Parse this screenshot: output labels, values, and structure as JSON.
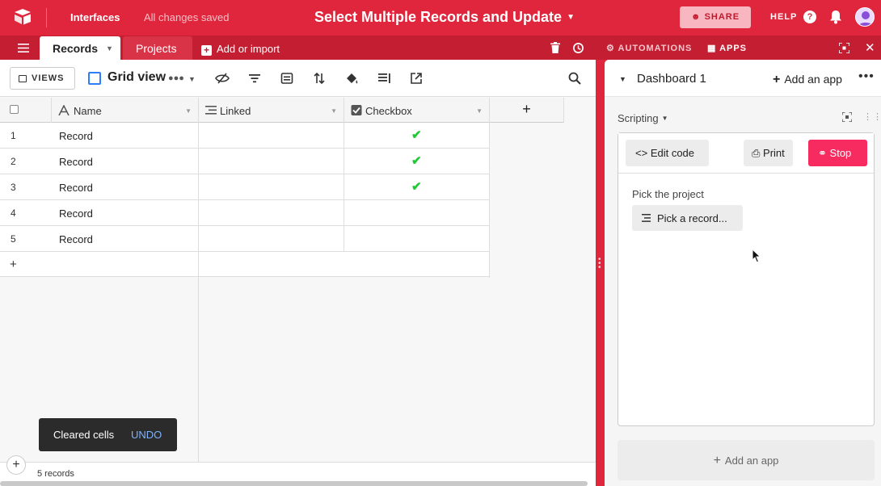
{
  "topbar": {
    "interfaces": "Interfaces",
    "saved": "All changes saved",
    "base_title": "Select Multiple Records and Update",
    "share": "SHARE",
    "help": "HELP"
  },
  "tabs": {
    "records": "Records",
    "projects": "Projects",
    "add_or_import": "Add or import",
    "automations": "AUTOMATIONS",
    "apps": "APPS"
  },
  "viewbar": {
    "views": "VIEWS",
    "grid_view": "Grid view"
  },
  "table": {
    "columns": [
      "Name",
      "Linked",
      "Checkbox"
    ],
    "rows": [
      {
        "num": "1",
        "name": "Record",
        "checked": true
      },
      {
        "num": "2",
        "name": "Record",
        "checked": true
      },
      {
        "num": "3",
        "name": "Record",
        "checked": true
      },
      {
        "num": "4",
        "name": "Record",
        "checked": false
      },
      {
        "num": "5",
        "name": "Record",
        "checked": false
      }
    ],
    "check_glyph": "✔",
    "add_row": "+",
    "add_column": "+"
  },
  "toast": {
    "message": "Cleared cells",
    "action": "UNDO"
  },
  "footer": {
    "record_count": "5 records"
  },
  "dashboard": {
    "title": "Dashboard 1",
    "add_app": "Add an app",
    "more": "•••",
    "app_name": "Scripting",
    "edit_code": "Edit code",
    "print": "Print",
    "stop": "Stop",
    "pick_label": "Pick the project",
    "pick_button": "Pick a record...",
    "add_app_bottom": "Add an app"
  },
  "colors": {
    "brand_red": "#e0263c",
    "stop_pink": "#f82b60",
    "check_green": "#20c933",
    "grid_blue": "#2d7ff9"
  }
}
